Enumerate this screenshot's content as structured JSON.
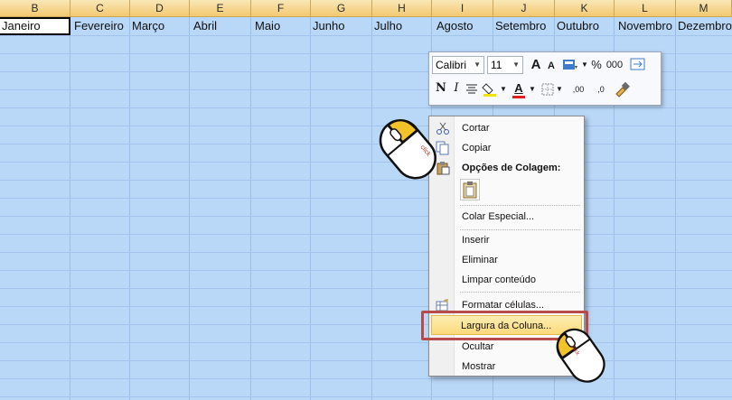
{
  "columns": [
    "B",
    "C",
    "D",
    "E",
    "F",
    "G",
    "H",
    "I",
    "J",
    "K",
    "L",
    "M"
  ],
  "months": [
    "Janeiro",
    "Fevereiro",
    "Março",
    "Abril",
    "Maio",
    "Junho",
    "Julho",
    "Agosto",
    "Setembro",
    "Outubro",
    "Novembro",
    "Dezembro"
  ],
  "toolbar": {
    "font_name": "Calibri",
    "font_size": "11",
    "grow_font": "A",
    "shrink_font": "A",
    "percent": "%",
    "thousands": "000",
    "bold": "N",
    "italic": "I",
    "font_color_letter": "A",
    "inc_decimal": ",00",
    "dec_decimal": ",0"
  },
  "context_menu": {
    "items": [
      {
        "label": "Cortar"
      },
      {
        "label": "Copiar"
      },
      {
        "label": "Opções de Colagem:"
      },
      {
        "label": "Colar Especial..."
      },
      {
        "label": "Inserir"
      },
      {
        "label": "Eliminar"
      },
      {
        "label": "Limpar conteúdo"
      },
      {
        "label": "Formatar células..."
      },
      {
        "label": "Largura da Coluna..."
      },
      {
        "label": "Ocultar"
      },
      {
        "label": "Mostrar"
      }
    ]
  },
  "mouse": {
    "click_label": "click"
  },
  "colors": {
    "grid_selected": "#b9d7f7",
    "header": "#f3c971",
    "highlight": "#b94a4a",
    "menu_hover": "#fbd97a",
    "mouse_button": "#f2c229"
  }
}
